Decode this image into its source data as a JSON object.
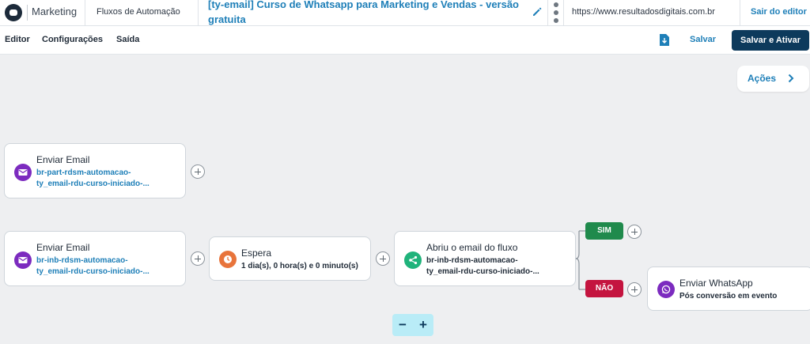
{
  "header": {
    "brand": "Marketing",
    "breadcrumb": "Fluxos de Automação",
    "flow_title": "[ty-email] Curso de Whatsapp para Marketing e Vendas - versão gratuita",
    "url": "https://www.resultadosdigitais.com.br",
    "exit_label": "Sair do editor"
  },
  "toolbar": {
    "tabs": [
      "Editor",
      "Configurações",
      "Saída"
    ],
    "save_label": "Salvar",
    "save_activate_label": "Salvar e Ativar"
  },
  "canvas": {
    "actions_label": "Ações",
    "nodes": {
      "email_1": {
        "title": "Enviar Email",
        "line1": "br-part-rdsm-automacao-",
        "line2": "ty_email-rdu-curso-iniciado-..."
      },
      "email_2": {
        "title": "Enviar Email",
        "line1": "br-inb-rdsm-automacao-",
        "line2": "ty_email-rdu-curso-iniciado-..."
      },
      "wait": {
        "title": "Espera",
        "detail": "1 dia(s), 0 hora(s) e 0 minuto(s)"
      },
      "condition": {
        "title": "Abriu o email do fluxo",
        "line1": "br-inb-rdsm-automacao-",
        "line2": "ty_email-rdu-curso-iniciado-..."
      },
      "whatsapp": {
        "title": "Enviar WhatsApp",
        "detail": "Pós conversão em evento"
      }
    },
    "branches": {
      "yes": "SIM",
      "no": "NÃO"
    },
    "zoom": {
      "out": "−",
      "in": "+"
    }
  },
  "icons": {
    "email": "envelope-icon",
    "wait": "clock-icon",
    "condition": "branch-icon",
    "whatsapp": "whatsapp-icon",
    "edit": "pencil-icon",
    "more": "kebab-icon",
    "document": "document-download-icon",
    "chevron": "chevron-right-icon"
  },
  "colors": {
    "primary": "#0d3a5c",
    "link": "#1e7fb8",
    "email_icon": "#7c2bbf",
    "wait_icon": "#e8743b",
    "condition_icon": "#20b37b",
    "whatsapp_icon": "#7c2bbf",
    "yes_branch": "#1f8a4c",
    "no_branch": "#c4143f",
    "zoom_bg": "#b9ecf7"
  }
}
